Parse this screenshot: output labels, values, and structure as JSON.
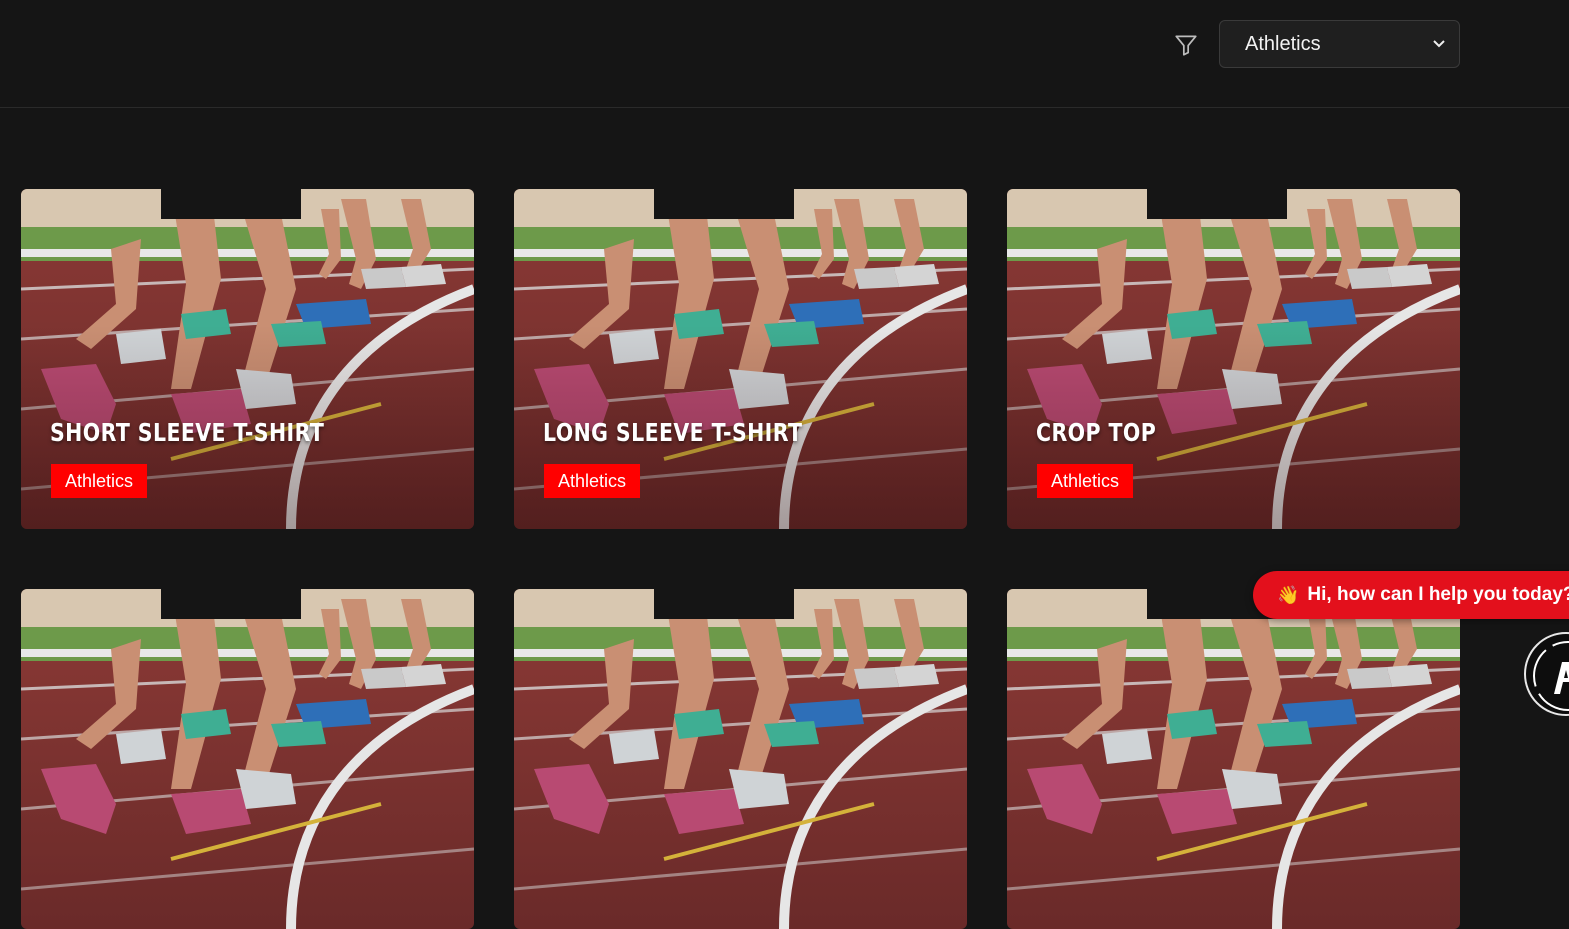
{
  "filter": {
    "icon": "filter-funnel-icon",
    "selected": "Athletics",
    "chevron_icon": "chevron-down-icon"
  },
  "cards": [
    {
      "title": "SHORT SLEEVE T-SHIRT",
      "tag": "Athletics"
    },
    {
      "title": "LONG SLEEVE T-SHIRT",
      "tag": "Athletics"
    },
    {
      "title": "CROP TOP",
      "tag": "Athletics"
    },
    {
      "title": "",
      "tag": ""
    },
    {
      "title": "",
      "tag": ""
    },
    {
      "title": "",
      "tag": ""
    }
  ],
  "chat": {
    "emoji": "👋",
    "message": "Hi, how can I help you today?",
    "avatar_icon": "brand-logo-icon"
  },
  "colors": {
    "background": "#151515",
    "tag_red": "#ff0000",
    "chat_red": "#e3101c"
  }
}
